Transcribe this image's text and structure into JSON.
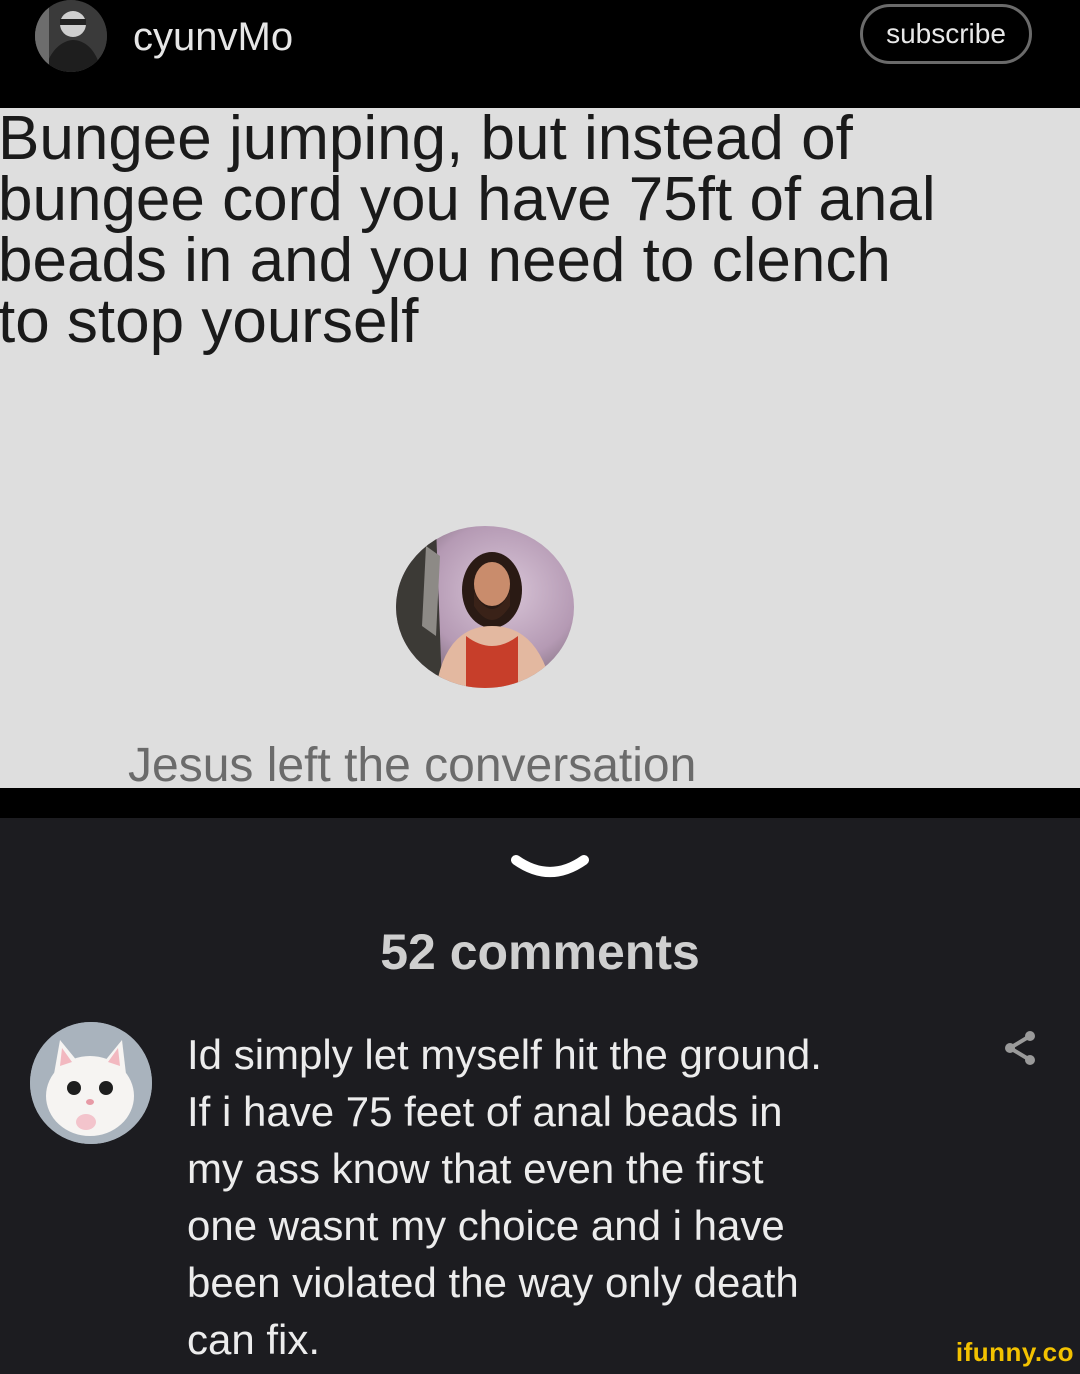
{
  "header": {
    "username": "cyunvMo",
    "subscribe_label": "subscribe"
  },
  "meme": {
    "lines": [
      "Bungee jumping, but instead of",
      "bungee cord you have 75ft of anal",
      "beads in and you need to clench",
      "to stop yourself"
    ],
    "caption": "Jesus left the conversation"
  },
  "comments": {
    "count_label": "52 comments",
    "items": [
      {
        "lines": [
          "Id simply let myself hit the ground.",
          "If i have 75 feet of anal beads in",
          "my ass know that even the first",
          "one wasnt my choice and i have",
          "been violated the way only death",
          "can fix."
        ]
      }
    ]
  },
  "watermark": "ifunny.co",
  "colors": {
    "watermark": "#f3c200",
    "comments_bg": "#1c1c20",
    "meme_bg": "#dedede"
  },
  "icons": [
    "user-avatar-icon",
    "chevron-down-icon",
    "share-icon"
  ]
}
